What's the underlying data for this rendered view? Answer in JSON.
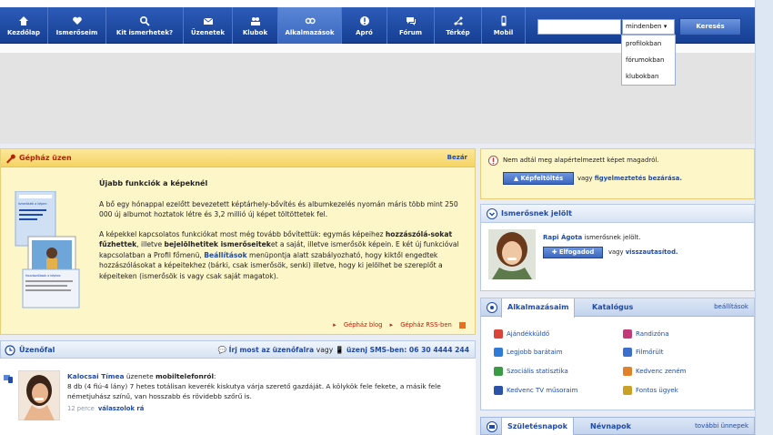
{
  "nav": {
    "items": [
      {
        "label": "Kezdőlap",
        "icon": "home-icon"
      },
      {
        "label": "Ismerőseim",
        "icon": "friends-icon"
      },
      {
        "label": "Kit ismerhetek?",
        "icon": "people-search-icon"
      },
      {
        "label": "Üzenetek",
        "icon": "messages-icon"
      },
      {
        "label": "Klubok",
        "icon": "clubs-icon"
      },
      {
        "label": "Alkalmazások",
        "icon": "apps-icon"
      },
      {
        "label": "Apró",
        "icon": "ads-icon"
      },
      {
        "label": "Fórum",
        "icon": "forum-icon"
      },
      {
        "label": "Térkép",
        "icon": "map-icon"
      },
      {
        "label": "Mobil",
        "icon": "mobile-icon"
      }
    ],
    "active_index": 5
  },
  "search": {
    "value": "",
    "scope_selected": "mindenben",
    "scope_options": [
      "profilokban",
      "fórumokban",
      "klubokban"
    ],
    "button_label": "Keresés"
  },
  "gephaz": {
    "title": "Gépház üzen",
    "close_label": "Bezár",
    "heading": "Újabb funkciók a képeknél",
    "p1": "A bő egy hónappal ezelőtt bevezetett képtárhely-bővítés és albumkezelés nyomán máris több mint 250 000 új albumot hoztatok létre és 3,2 millió új képet töltöttetek fel.",
    "p2_a": "A képekkel kapcsolatos funkciókat most még tovább bővítettük: egymás képeihez ",
    "p2_b": "hozzászólá-sokat fűzhettek",
    "p2_c": ", illetve ",
    "p2_d": "bejelölhetitek ismerőseitek",
    "p2_e": "et a saját, illetve ismerősök képein. E két új funkcióval kapcsolatban a Profil főmenü, ",
    "p2_f": "Beállítások",
    "p2_g": " menüpontja alatt szabályozható, hogy kiktől engedtek hozzászólásokat a képeitekhez (bárki, csak ismerősök, senki) illetve, hogy ki jelölhet be szereplőt a képeiteken (ismerősök is vagy csak saját magatok).",
    "foot_blog": "Gépház blog",
    "foot_rss": "Gépház RSS-ben",
    "illus_caption_1": "Ismerőseik a képen:",
    "illus_caption_2": "Hozzászólások a képhez"
  },
  "uzenofal": {
    "title": "Üzenőfal",
    "write_link": "Írj most az üzenőfalra",
    "or": "vagy",
    "sms_text": "üzenj SMS-ben: 06 30 4444 244",
    "msg_name": "Kalocsai Tímea",
    "msg_mid": " üzenete ",
    "msg_source": "mobiltelefonról",
    "msg_colon": ":",
    "msg_text": "8 db (4 fiú-4 lány) 7 hetes totálisan keverék kiskutya várja szerető gazdáját. A kölykök fele fekete, a másik fele németjuhász színű, van hosszabb és rövidebb szőrű is.",
    "msg_ago": "12 perce",
    "msg_reply": "válaszolok rá"
  },
  "notice": {
    "text": "Nem adtál meg alapértelmezett képet magadról.",
    "upload_label": "Képfeltöltés",
    "or": "vagy",
    "dismiss": "figyelmeztetés bezárása."
  },
  "friendreq": {
    "title": "Ismerősnek jelölt",
    "name": "Rapi Ágota",
    "suffix": " ismerősnek jelölt.",
    "accept_label": "Elfogadod",
    "or": "vagy",
    "reject": "visszautasítod."
  },
  "apps": {
    "tabs": [
      "Alkalmazásaim",
      "Katalógus"
    ],
    "settings": "beállítások",
    "items": [
      {
        "label": "Ajándékküldő",
        "color": "#d9453a",
        "icon": "gift-icon"
      },
      {
        "label": "Randizóna",
        "color": "#c33a7a",
        "icon": "heart-icon"
      },
      {
        "label": "Legjobb barátaim",
        "color": "#2d7bd6",
        "icon": "star-icon"
      },
      {
        "label": "Filmőrült",
        "color": "#3a6fd0",
        "icon": "film-icon"
      },
      {
        "label": "Szociális statisztika",
        "color": "#3b9a45",
        "icon": "stats-icon"
      },
      {
        "label": "Kedvenc zeném",
        "color": "#e0822a",
        "icon": "music-icon"
      },
      {
        "label": "Kedvenc TV műsoraim",
        "color": "#2a52a8",
        "icon": "tv-icon"
      },
      {
        "label": "Fontos ügyek",
        "color": "#c9a225",
        "icon": "flower-icon"
      }
    ]
  },
  "bdays": {
    "tabs": [
      "Születésnapok",
      "Névnapok"
    ],
    "more": "további ünnepek"
  },
  "colors": {
    "nav_bg": "#1f4ca7",
    "link": "#1f4aa8",
    "accent_red": "#b3230b",
    "notice_bg": "#fdf6c8"
  }
}
